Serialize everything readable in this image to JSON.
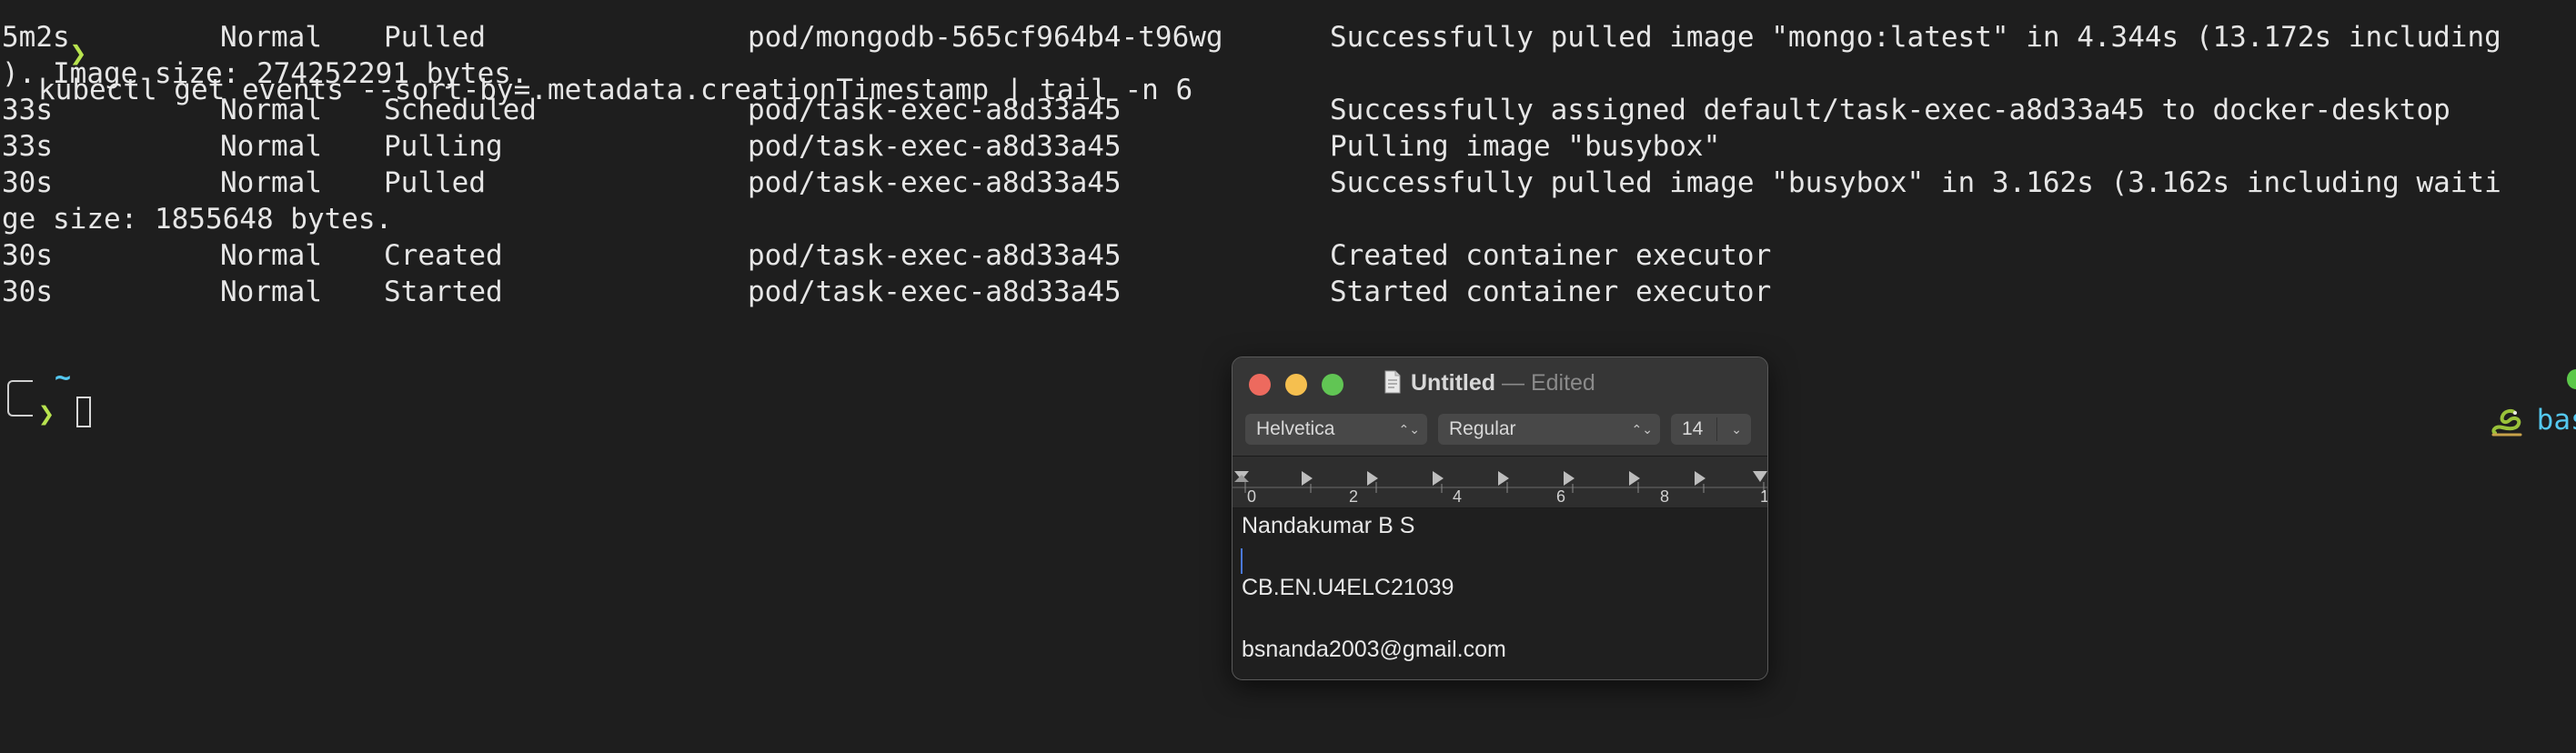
{
  "terminal": {
    "command_line": {
      "arrow": "❯",
      "command": "kubectl get events --sort-by=.metadata.creationTimestamp | tail -n 6"
    },
    "event_rows": [
      {
        "age": "5m2s",
        "type": "Normal",
        "reason": "Pulled",
        "object": "pod/mongodb-565cf964b4-t96wg",
        "message": "Successfully pulled image \"mongo:latest\" in 4.344s (13.172s including",
        "wrap": "). Image size: 274252291 bytes."
      },
      {
        "age": "33s",
        "type": "Normal",
        "reason": "Scheduled",
        "object": "pod/task-exec-a8d33a45",
        "message": "Successfully assigned default/task-exec-a8d33a45 to docker-desktop"
      },
      {
        "age": "33s",
        "type": "Normal",
        "reason": "Pulling",
        "object": "pod/task-exec-a8d33a45",
        "message": "Pulling image \"busybox\""
      },
      {
        "age": "30s",
        "type": "Normal",
        "reason": "Pulled",
        "object": "pod/task-exec-a8d33a45",
        "message": "Successfully pulled image \"busybox\" in 3.162s (3.162s including waiti",
        "wrap": "ge size: 1855648 bytes."
      },
      {
        "age": "30s",
        "type": "Normal",
        "reason": "Created",
        "object": "pod/task-exec-a8d33a45",
        "message": "Created container executor"
      },
      {
        "age": "30s",
        "type": "Normal",
        "reason": "Started",
        "object": "pod/task-exec-a8d33a45",
        "message": "Started container executor"
      }
    ],
    "prompt": {
      "directory": "~",
      "chevron": "❯"
    },
    "right_prompt": {
      "env_name": "base",
      "icon": "python-snake-icon"
    },
    "colors": {
      "background": "#1e1e1e",
      "text": "#e6e6e6",
      "prompt_green": "#b8e34f",
      "prompt_cyan": "#54c8f0"
    }
  },
  "textedit": {
    "title": "Untitled",
    "title_separator": "—",
    "title_status": "Edited",
    "font_family_select": "Helvetica",
    "font_style_select": "Regular",
    "font_size": "14",
    "ruler_labels": [
      "0",
      "2",
      "4",
      "6",
      "8",
      "1"
    ],
    "document_lines": [
      "Nandakumar B S",
      "",
      "CB.EN.U4ELC21039",
      "",
      "bsnanda2003@gmail.com"
    ],
    "colors": {
      "close": "#ed6a5e",
      "minimize": "#f5bf4f",
      "maximize": "#61c554",
      "caret": "#4a78d8"
    }
  }
}
